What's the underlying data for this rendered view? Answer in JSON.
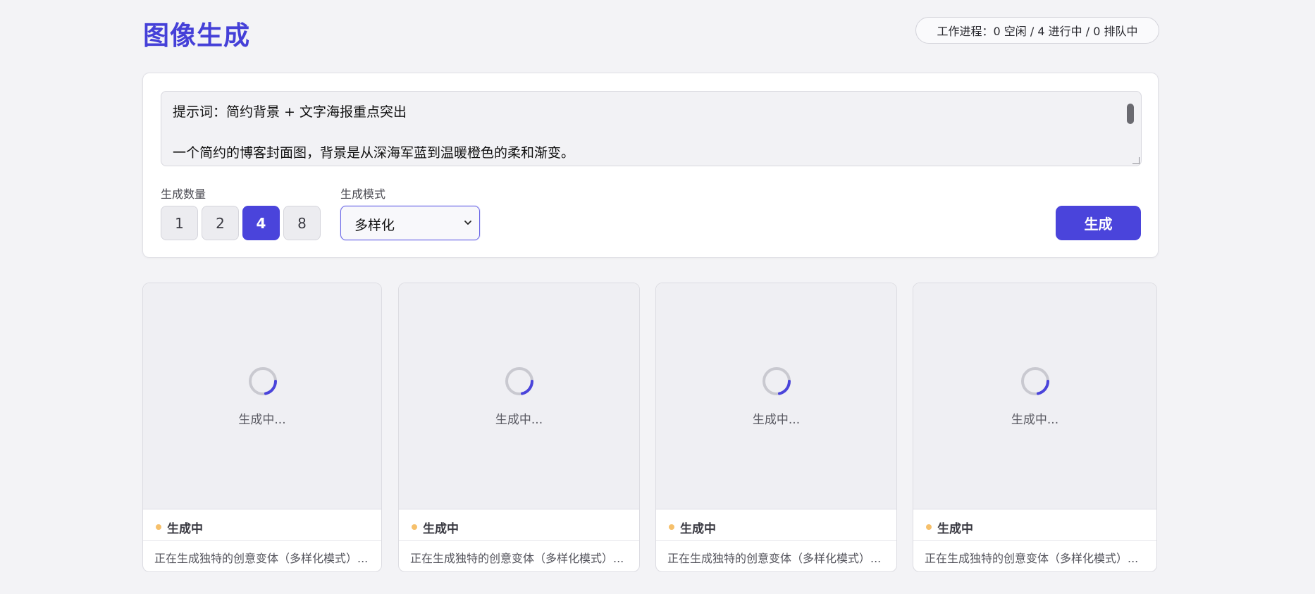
{
  "header": {
    "title": "图像生成",
    "worker_status": "工作进程：0 空闲 / 4 进行中 / 0 排队中"
  },
  "prompt": {
    "line1": "提示词：简约背景 + 文字海报重点突出",
    "line2": "一个简约的博客封面图，背景是从深海军蓝到温暖橙色的柔和渐变。"
  },
  "controls": {
    "count_label": "生成数量",
    "count_options": [
      "1",
      "2",
      "4",
      "8"
    ],
    "count_selected": "4",
    "mode_label": "生成模式",
    "mode_value": "多样化",
    "generate_label": "生成"
  },
  "colors": {
    "accent": "#4a44db",
    "status_pending": "#f6c06b"
  },
  "cards": [
    {
      "loading": "生成中...",
      "status": "生成中",
      "description": "正在生成独特的创意变体（多样化模式）..."
    },
    {
      "loading": "生成中...",
      "status": "生成中",
      "description": "正在生成独特的创意变体（多样化模式）..."
    },
    {
      "loading": "生成中...",
      "status": "生成中",
      "description": "正在生成独特的创意变体（多样化模式）..."
    },
    {
      "loading": "生成中...",
      "status": "生成中",
      "description": "正在生成独特的创意变体（多样化模式）..."
    }
  ]
}
